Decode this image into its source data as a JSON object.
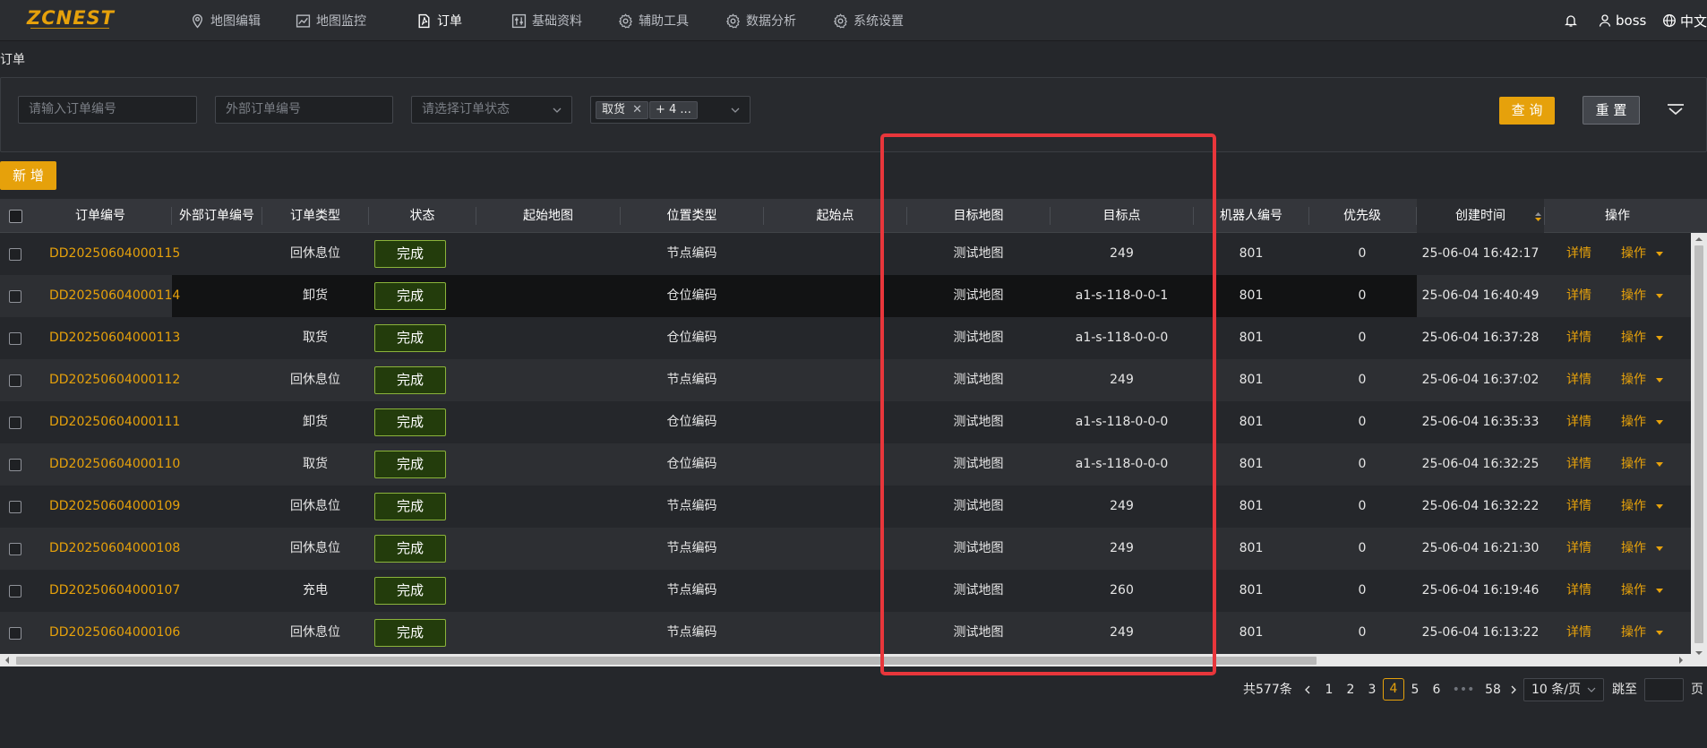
{
  "app": {
    "logo": "ZCNEST",
    "nav": [
      {
        "label": "地图编辑",
        "icon": "location-pin-icon"
      },
      {
        "label": "地图监控",
        "icon": "line-chart-icon"
      },
      {
        "label": "订单",
        "icon": "pdf-document-icon",
        "active": true
      },
      {
        "label": "基础资料",
        "icon": "sliders-icon"
      },
      {
        "label": "辅助工具",
        "icon": "gear-icon"
      },
      {
        "label": "数据分析",
        "icon": "gear-icon"
      },
      {
        "label": "系统设置",
        "icon": "gear-icon"
      }
    ],
    "user": "boss",
    "language": "中文"
  },
  "page": {
    "title": "订单"
  },
  "filters": {
    "order_no_placeholder": "请输入订单编号",
    "external_no_placeholder": "外部订单编号",
    "status_placeholder": "请选择订单状态",
    "type_tag": "取货",
    "type_more": "+ 4 ...",
    "query_label": "查 询",
    "reset_label": "重 置"
  },
  "toolbar": {
    "add_label": "新 增"
  },
  "table": {
    "columns": [
      "订单编号",
      "外部订单编号",
      "订单类型",
      "状态",
      "起始地图",
      "位置类型",
      "起始点",
      "目标地图",
      "目标点",
      "机器人编号",
      "优先级",
      "创建时间",
      "操作"
    ],
    "detail_label": "详情",
    "action_label": "操作",
    "rows": [
      {
        "order_no": "DD20250604000115",
        "external_no": "",
        "type": "回休息位",
        "status": "完成",
        "start_map": "",
        "location_type": "节点编码",
        "start_point": "",
        "target_map": "测试地图",
        "target_point": "249",
        "robot_no": "801",
        "priority": "0",
        "created": "25-06-04 16:42:17"
      },
      {
        "order_no": "DD20250604000114",
        "external_no": "",
        "type": "卸货",
        "status": "完成",
        "start_map": "",
        "location_type": "仓位编码",
        "start_point": "",
        "target_map": "测试地图",
        "target_point": "a1-s-118-0-0-1",
        "robot_no": "801",
        "priority": "0",
        "created": "25-06-04 16:40:49"
      },
      {
        "order_no": "DD20250604000113",
        "external_no": "",
        "type": "取货",
        "status": "完成",
        "start_map": "",
        "location_type": "仓位编码",
        "start_point": "",
        "target_map": "测试地图",
        "target_point": "a1-s-118-0-0-0",
        "robot_no": "801",
        "priority": "0",
        "created": "25-06-04 16:37:28"
      },
      {
        "order_no": "DD20250604000112",
        "external_no": "",
        "type": "回休息位",
        "status": "完成",
        "start_map": "",
        "location_type": "节点编码",
        "start_point": "",
        "target_map": "测试地图",
        "target_point": "249",
        "robot_no": "801",
        "priority": "0",
        "created": "25-06-04 16:37:02"
      },
      {
        "order_no": "DD20250604000111",
        "external_no": "",
        "type": "卸货",
        "status": "完成",
        "start_map": "",
        "location_type": "仓位编码",
        "start_point": "",
        "target_map": "测试地图",
        "target_point": "a1-s-118-0-0-0",
        "robot_no": "801",
        "priority": "0",
        "created": "25-06-04 16:35:33"
      },
      {
        "order_no": "DD20250604000110",
        "external_no": "",
        "type": "取货",
        "status": "完成",
        "start_map": "",
        "location_type": "仓位编码",
        "start_point": "",
        "target_map": "测试地图",
        "target_point": "a1-s-118-0-0-0",
        "robot_no": "801",
        "priority": "0",
        "created": "25-06-04 16:32:25"
      },
      {
        "order_no": "DD20250604000109",
        "external_no": "",
        "type": "回休息位",
        "status": "完成",
        "start_map": "",
        "location_type": "节点编码",
        "start_point": "",
        "target_map": "测试地图",
        "target_point": "249",
        "robot_no": "801",
        "priority": "0",
        "created": "25-06-04 16:32:22"
      },
      {
        "order_no": "DD20250604000108",
        "external_no": "",
        "type": "回休息位",
        "status": "完成",
        "start_map": "",
        "location_type": "节点编码",
        "start_point": "",
        "target_map": "测试地图",
        "target_point": "249",
        "robot_no": "801",
        "priority": "0",
        "created": "25-06-04 16:21:30"
      },
      {
        "order_no": "DD20250604000107",
        "external_no": "",
        "type": "充电",
        "status": "完成",
        "start_map": "",
        "location_type": "节点编码",
        "start_point": "",
        "target_map": "测试地图",
        "target_point": "260",
        "robot_no": "801",
        "priority": "0",
        "created": "25-06-04 16:19:46"
      },
      {
        "order_no": "DD20250604000106",
        "external_no": "",
        "type": "回休息位",
        "status": "完成",
        "start_map": "",
        "location_type": "节点编码",
        "start_point": "",
        "target_map": "测试地图",
        "target_point": "249",
        "robot_no": "801",
        "priority": "0",
        "created": "25-06-04 16:13:22"
      }
    ]
  },
  "pagination": {
    "total": "共577条",
    "pages": [
      "1",
      "2",
      "3",
      "4",
      "5",
      "6",
      "•••",
      "58"
    ],
    "current": "4",
    "page_size": "10 条/页",
    "jump_label": "跳至",
    "page_suffix": "页"
  },
  "colors": {
    "accent": "#e6a10b",
    "status_bg": "#233c0c",
    "status_border": "#8bb33b",
    "highlight_box": "#e8363b"
  }
}
